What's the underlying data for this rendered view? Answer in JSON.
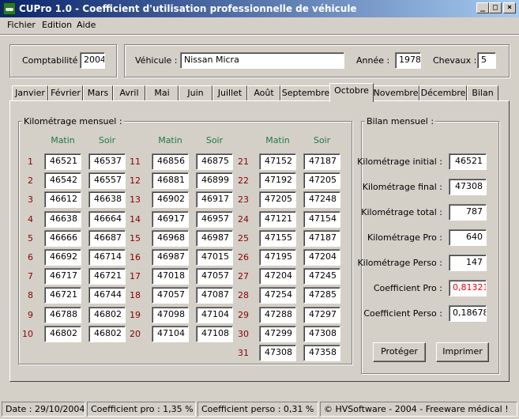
{
  "window": {
    "title": "CUPro 1.0 - Coefficient d'utilisation professionnelle de véhicule",
    "controls": {
      "minimize": "_",
      "maximize": "□",
      "close": "×"
    }
  },
  "menu": [
    {
      "label": "Fichier"
    },
    {
      "label": "Edition"
    },
    {
      "label": "Aide"
    }
  ],
  "header": {
    "comptabilite_label": "Comptabilité :",
    "comptabilite_value": "2004",
    "vehicule_label": "Véhicule :",
    "vehicule_value": "Nissan Micra",
    "annee_label": "Année :",
    "annee_value": "1978",
    "chevaux_label": "Chevaux :",
    "chevaux_value": "5"
  },
  "tabs": {
    "items": [
      "Janvier",
      "Février",
      "Mars",
      "Avril",
      "Mai",
      "Juin",
      "Juillet",
      "Août",
      "Septembre",
      "Octobre",
      "Novembre",
      "Décembre",
      "Bilan"
    ],
    "active": "Octobre"
  },
  "km": {
    "group_title": "Kilométrage mensuel :",
    "col_matin": "Matin",
    "col_soir": "Soir",
    "rows": [
      {
        "day": "1",
        "matin": "46521",
        "soir": "46537"
      },
      {
        "day": "2",
        "matin": "46542",
        "soir": "46557"
      },
      {
        "day": "3",
        "matin": "46612",
        "soir": "46638"
      },
      {
        "day": "4",
        "matin": "46638",
        "soir": "46664"
      },
      {
        "day": "5",
        "matin": "46666",
        "soir": "46687"
      },
      {
        "day": "6",
        "matin": "46692",
        "soir": "46714"
      },
      {
        "day": "7",
        "matin": "46717",
        "soir": "46721"
      },
      {
        "day": "8",
        "matin": "46721",
        "soir": "46744"
      },
      {
        "day": "9",
        "matin": "46788",
        "soir": "46802"
      },
      {
        "day": "10",
        "matin": "46802",
        "soir": "46802"
      },
      {
        "day": "11",
        "matin": "46856",
        "soir": "46875"
      },
      {
        "day": "12",
        "matin": "46881",
        "soir": "46899"
      },
      {
        "day": "13",
        "matin": "46902",
        "soir": "46917"
      },
      {
        "day": "14",
        "matin": "46917",
        "soir": "46957"
      },
      {
        "day": "15",
        "matin": "46968",
        "soir": "46987"
      },
      {
        "day": "16",
        "matin": "46987",
        "soir": "47015"
      },
      {
        "day": "17",
        "matin": "47018",
        "soir": "47057"
      },
      {
        "day": "18",
        "matin": "47057",
        "soir": "47087"
      },
      {
        "day": "19",
        "matin": "47098",
        "soir": "47104"
      },
      {
        "day": "20",
        "matin": "47104",
        "soir": "47108"
      },
      {
        "day": "21",
        "matin": "47152",
        "soir": "47187"
      },
      {
        "day": "22",
        "matin": "47192",
        "soir": "47205"
      },
      {
        "day": "23",
        "matin": "47205",
        "soir": "47248"
      },
      {
        "day": "24",
        "matin": "47121",
        "soir": "47154"
      },
      {
        "day": "25",
        "matin": "47155",
        "soir": "47187"
      },
      {
        "day": "26",
        "matin": "47195",
        "soir": "47204"
      },
      {
        "day": "27",
        "matin": "47204",
        "soir": "47245"
      },
      {
        "day": "28",
        "matin": "47254",
        "soir": "47285"
      },
      {
        "day": "29",
        "matin": "47288",
        "soir": "47297"
      },
      {
        "day": "30",
        "matin": "47299",
        "soir": "47308"
      },
      {
        "day": "31",
        "matin": "47308",
        "soir": "47358"
      }
    ]
  },
  "bilan": {
    "group_title": "Bilan mensuel :",
    "items": [
      {
        "label": "Kilométrage initial :",
        "value": "46521"
      },
      {
        "label": "Kilométrage final :",
        "value": "47308"
      },
      {
        "label": "Kilométrage total :",
        "value": "787"
      },
      {
        "label": "Kilométrage Pro :",
        "value": "640"
      },
      {
        "label": "Kilométrage Perso :",
        "value": "147"
      },
      {
        "label": "Coefficient Pro :",
        "value": "0,81321",
        "color": "#ff0000"
      },
      {
        "label": "Coefficient Perso :",
        "value": "0,18678"
      }
    ],
    "proteger_label": "Protéger",
    "imprimer_label": "Imprimer"
  },
  "status": {
    "date": "Date : 29/10/2004",
    "coef_pro": "Coefficient pro : 1,35 %",
    "coef_perso": "Coefficient perso : 0,31 %",
    "copyright": "© HVSoftware - 2004 - Freeware médical !"
  },
  "colors": {
    "title_start": "#0a246a",
    "title_end": "#a6caf0",
    "column_header": "#1f7a43",
    "day_number": "#8b0000",
    "coef_pro_value": "#ff0000"
  }
}
